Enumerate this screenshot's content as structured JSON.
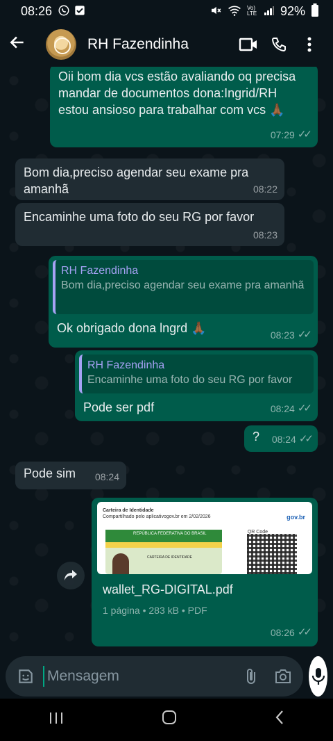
{
  "status_bar": {
    "time": "08:26",
    "battery": "92%",
    "icons": [
      "whatsapp-icon",
      "check-box-icon",
      "mute-icon",
      "wifi-icon",
      "volte-icon",
      "signal-icon",
      "battery-icon"
    ],
    "volte_label": "Vo) LTE"
  },
  "header": {
    "contact_name": "RH Fazendinha",
    "icons": [
      "back-arrow-icon",
      "video-call-icon",
      "phone-icon",
      "more-options-icon"
    ]
  },
  "messages": [
    {
      "direction": "out",
      "text": "Oii bom dia vcs estão avaliando oq precisa mandar de documentos dona:Ingrid/RH estou ansioso para trabalhar com vcs 🙏🏾",
      "time": "07:29",
      "status": "read"
    },
    {
      "direction": "in",
      "text": "Bom dia,preciso agendar seu exame pra amanhã",
      "time": "08:22"
    },
    {
      "direction": "in",
      "text": "Encaminhe uma foto do seu RG por favor",
      "time": "08:23"
    },
    {
      "direction": "out",
      "quote_name": "RH Fazendinha",
      "quote_text": "Bom dia,preciso agendar seu exame pra amanhã",
      "text": "Ok obrigado dona lngrd 🙏🏾",
      "time": "08:23",
      "status": "read"
    },
    {
      "direction": "out",
      "quote_name": "RH Fazendinha",
      "quote_text": "Encaminhe uma foto do seu RG por favor",
      "text": "Pode ser pdf",
      "time": "08:24",
      "status": "read"
    },
    {
      "direction": "out",
      "text": "?",
      "time": "08:24",
      "status": "read"
    },
    {
      "direction": "in",
      "text": "Pode sim",
      "time": "08:24"
    },
    {
      "direction": "out",
      "type": "document",
      "file_name": "wallet_RG-DIGITAL.pdf",
      "file_info": "1 página • 283 kB • PDF",
      "time": "08:26",
      "status": "read",
      "thumb": {
        "doc_title": "Carteira de Identidade",
        "shared_via": "Compartilhado pelo aplicativogov.br em 2/02/2026",
        "brand": "gov.br",
        "qr_label": "QR Code",
        "card_title": "REPÚBLICA FEDERATIVA DO BRASIL",
        "card_subtitle": "CARTEIRA DE IDENTIDADE"
      }
    }
  ],
  "input": {
    "placeholder": "Mensagem",
    "icons": [
      "sticker-icon",
      "attach-icon",
      "camera-icon",
      "mic-icon"
    ]
  },
  "nav_bar": {
    "icons": [
      "recents-icon",
      "home-icon",
      "back-icon"
    ]
  },
  "colors": {
    "background": "#0b141a",
    "outgoing_bubble": "#005c4b",
    "incoming_bubble": "#202c33",
    "quote_accent": "#a5a2f4",
    "accent": "#00a884"
  }
}
